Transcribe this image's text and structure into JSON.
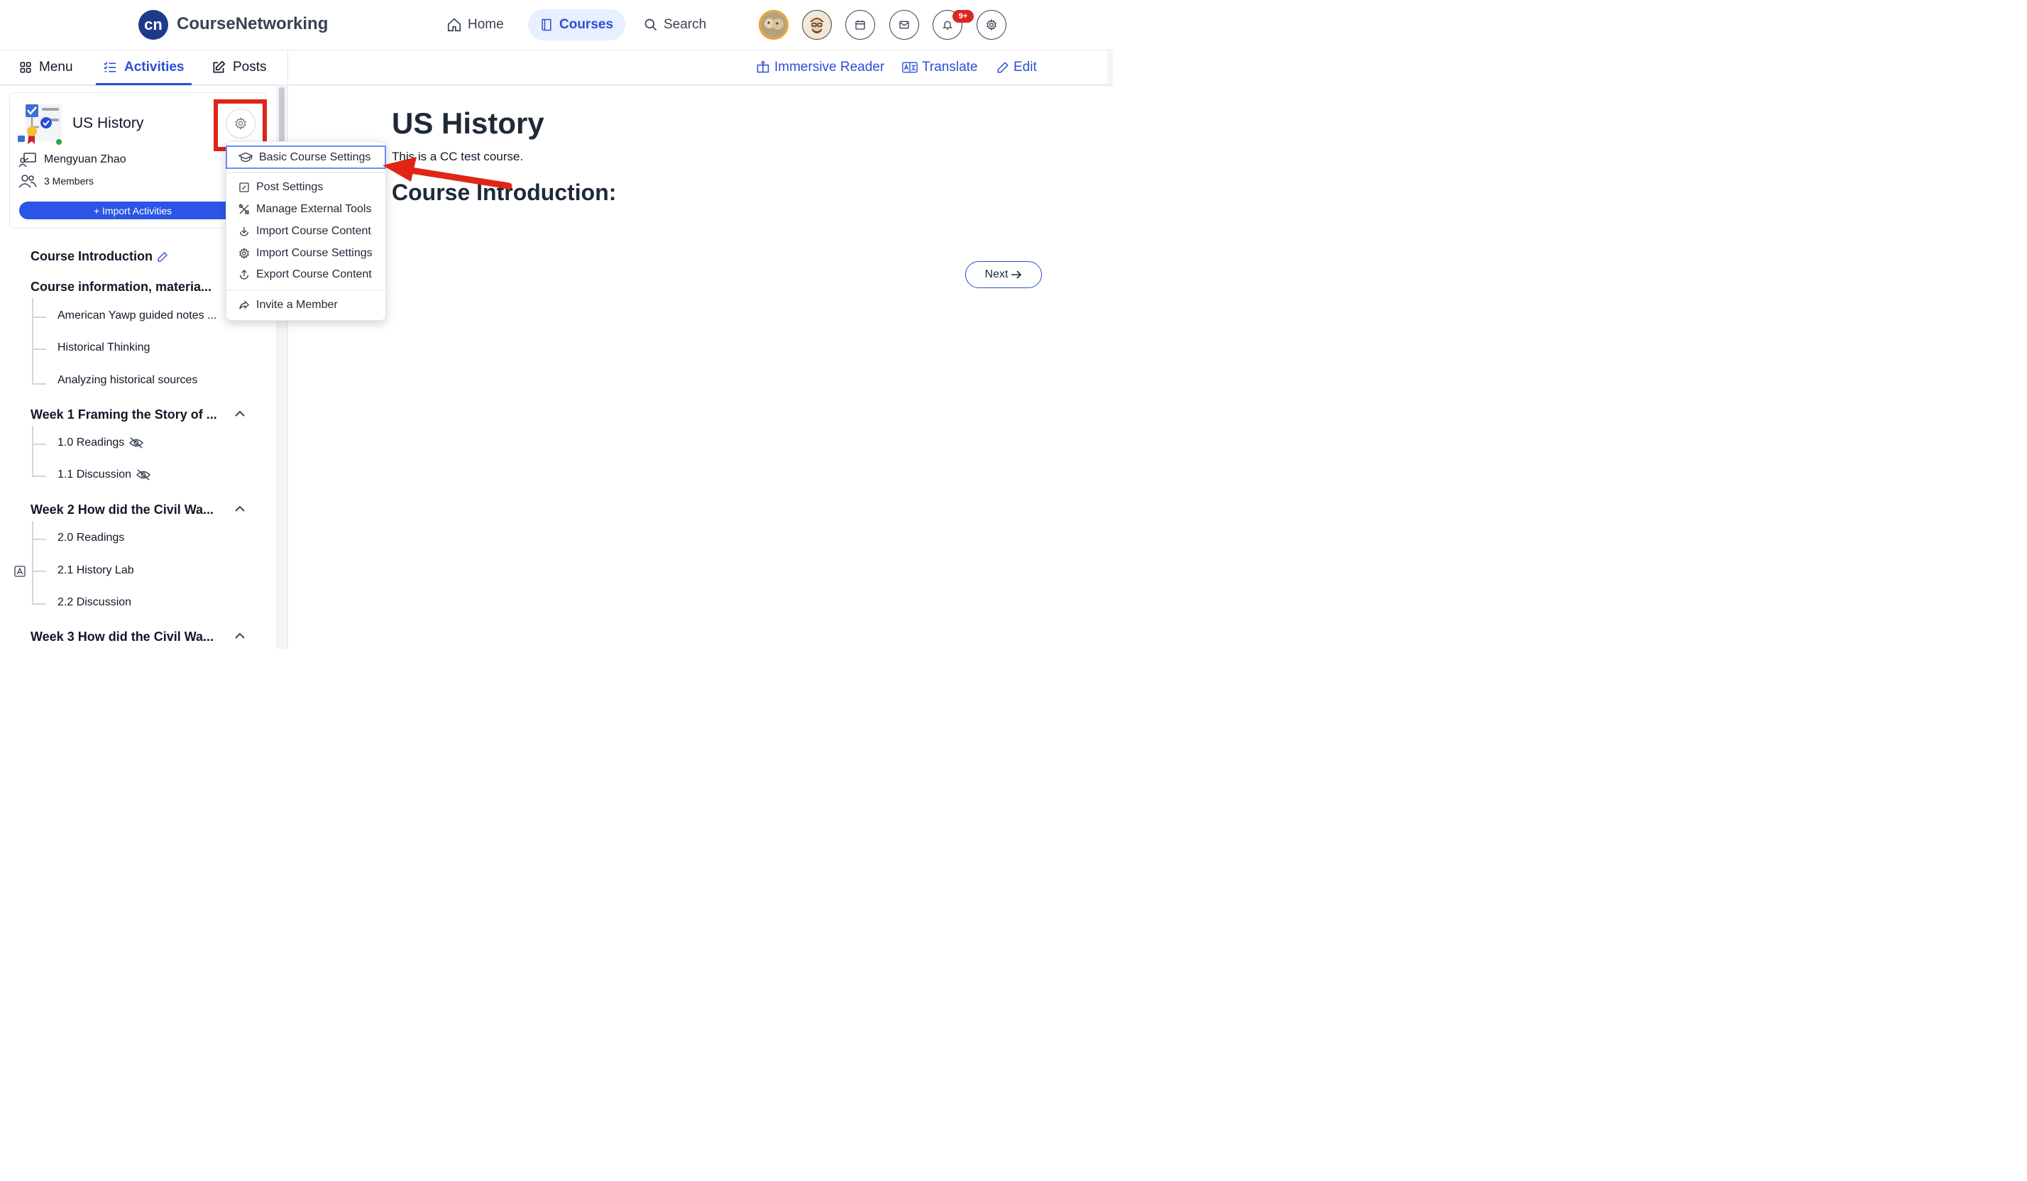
{
  "brand": {
    "logo_text": "cn",
    "name": "CourseNetworking"
  },
  "nav": {
    "home": "Home",
    "courses": "Courses",
    "search": "Search",
    "notif_badge": "9+"
  },
  "tabs": {
    "menu": "Menu",
    "activities": "Activities",
    "posts": "Posts"
  },
  "tools": {
    "immersive_reader": "Immersive Reader",
    "translate": "Translate",
    "edit": "Edit"
  },
  "course": {
    "title": "US History",
    "instructor": "Mengyuan Zhao",
    "members": "3 Members",
    "import_btn": "+ Import Activities"
  },
  "outline": {
    "intro": "Course Introduction",
    "info": "Course information, materia...",
    "info_items": [
      "American Yawp guided notes ...",
      "Historical Thinking",
      "Analyzing historical sources"
    ],
    "week1": "Week 1 Framing the Story of ...",
    "week1_items": [
      "1.0 Readings",
      "1.1 Discussion"
    ],
    "week2": "Week 2 How did the Civil Wa...",
    "week2_items": [
      "2.0 Readings",
      "2.1 History Lab",
      "2.2 Discussion"
    ],
    "week3": "Week 3 How did the Civil Wa..."
  },
  "settings_menu": {
    "basic": "Basic Course Settings",
    "post": "Post Settings",
    "external": "Manage External Tools",
    "import_content": "Import Course Content",
    "import_settings": "Import Course Settings",
    "export": "Export Course Content",
    "invite": "Invite a Member"
  },
  "main": {
    "title": "US History",
    "description": "This is a CC test course.",
    "subtitle": "Course Introduction:",
    "next": "Next"
  },
  "colors": {
    "accent": "#2b4fd6",
    "annotation": "#e02416",
    "badge": "#dc2626"
  }
}
